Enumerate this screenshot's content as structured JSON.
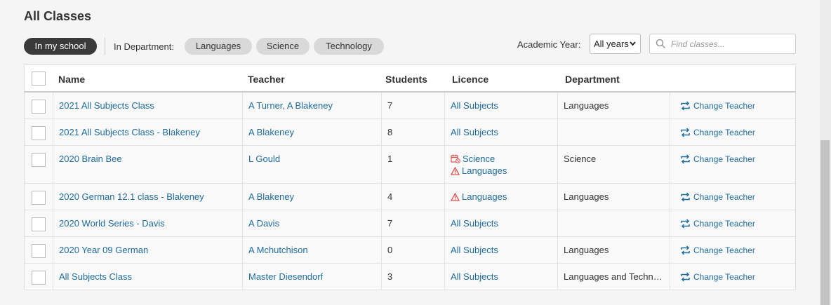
{
  "page": {
    "title": "All Classes"
  },
  "filters": {
    "in_my_school": "In my school",
    "dept_label": "In Department:",
    "departments": [
      "Languages",
      "Science",
      "Technology"
    ],
    "year_label": "Academic Year:",
    "year_value": "All years",
    "search_placeholder": "Find classes..."
  },
  "table": {
    "headers": {
      "name": "Name",
      "teacher": "Teacher",
      "students": "Students",
      "licence": "Licence",
      "department": "Department"
    },
    "action_label": "Change Teacher",
    "rows": [
      {
        "name": "2021 All Subjects Class",
        "teacher": "A Turner, A Blakeney",
        "students": "7",
        "licence": [
          {
            "text": "All Subjects",
            "icon": ""
          }
        ],
        "department": "Languages"
      },
      {
        "name": "2021 All Subjects Class - Blakeney",
        "teacher": "A Blakeney",
        "students": "8",
        "licence": [
          {
            "text": "All Subjects",
            "icon": ""
          }
        ],
        "department": ""
      },
      {
        "name": "2020 Brain Bee",
        "teacher": "L Gould",
        "students": "1",
        "licence": [
          {
            "text": "Science",
            "icon": "calendar-expired-icon"
          },
          {
            "text": "Languages",
            "icon": "warning-icon"
          }
        ],
        "department": "Science"
      },
      {
        "name": "2020 German 12.1 class - Blakeney",
        "teacher": "A Blakeney",
        "students": "4",
        "licence": [
          {
            "text": "Languages",
            "icon": "warning-icon"
          }
        ],
        "department": "Languages"
      },
      {
        "name": "2020 World Series - Davis",
        "teacher": "A Davis",
        "students": "7",
        "licence": [
          {
            "text": "All Subjects",
            "icon": ""
          }
        ],
        "department": ""
      },
      {
        "name": "2020 Year 09 German",
        "teacher": "A Mchutchison",
        "students": "0",
        "licence": [
          {
            "text": "All Subjects",
            "icon": ""
          }
        ],
        "department": "Languages"
      },
      {
        "name": "All Subjects Class",
        "teacher": "Master Diesendorf",
        "students": "3",
        "licence": [
          {
            "text": "All Subjects",
            "icon": ""
          }
        ],
        "department": "Languages and Techn…"
      }
    ]
  },
  "colors": {
    "link": "#1f6c9e",
    "warning": "#d9534f",
    "active_pill": "#3a3a3a",
    "pill": "#d9d9d9"
  }
}
